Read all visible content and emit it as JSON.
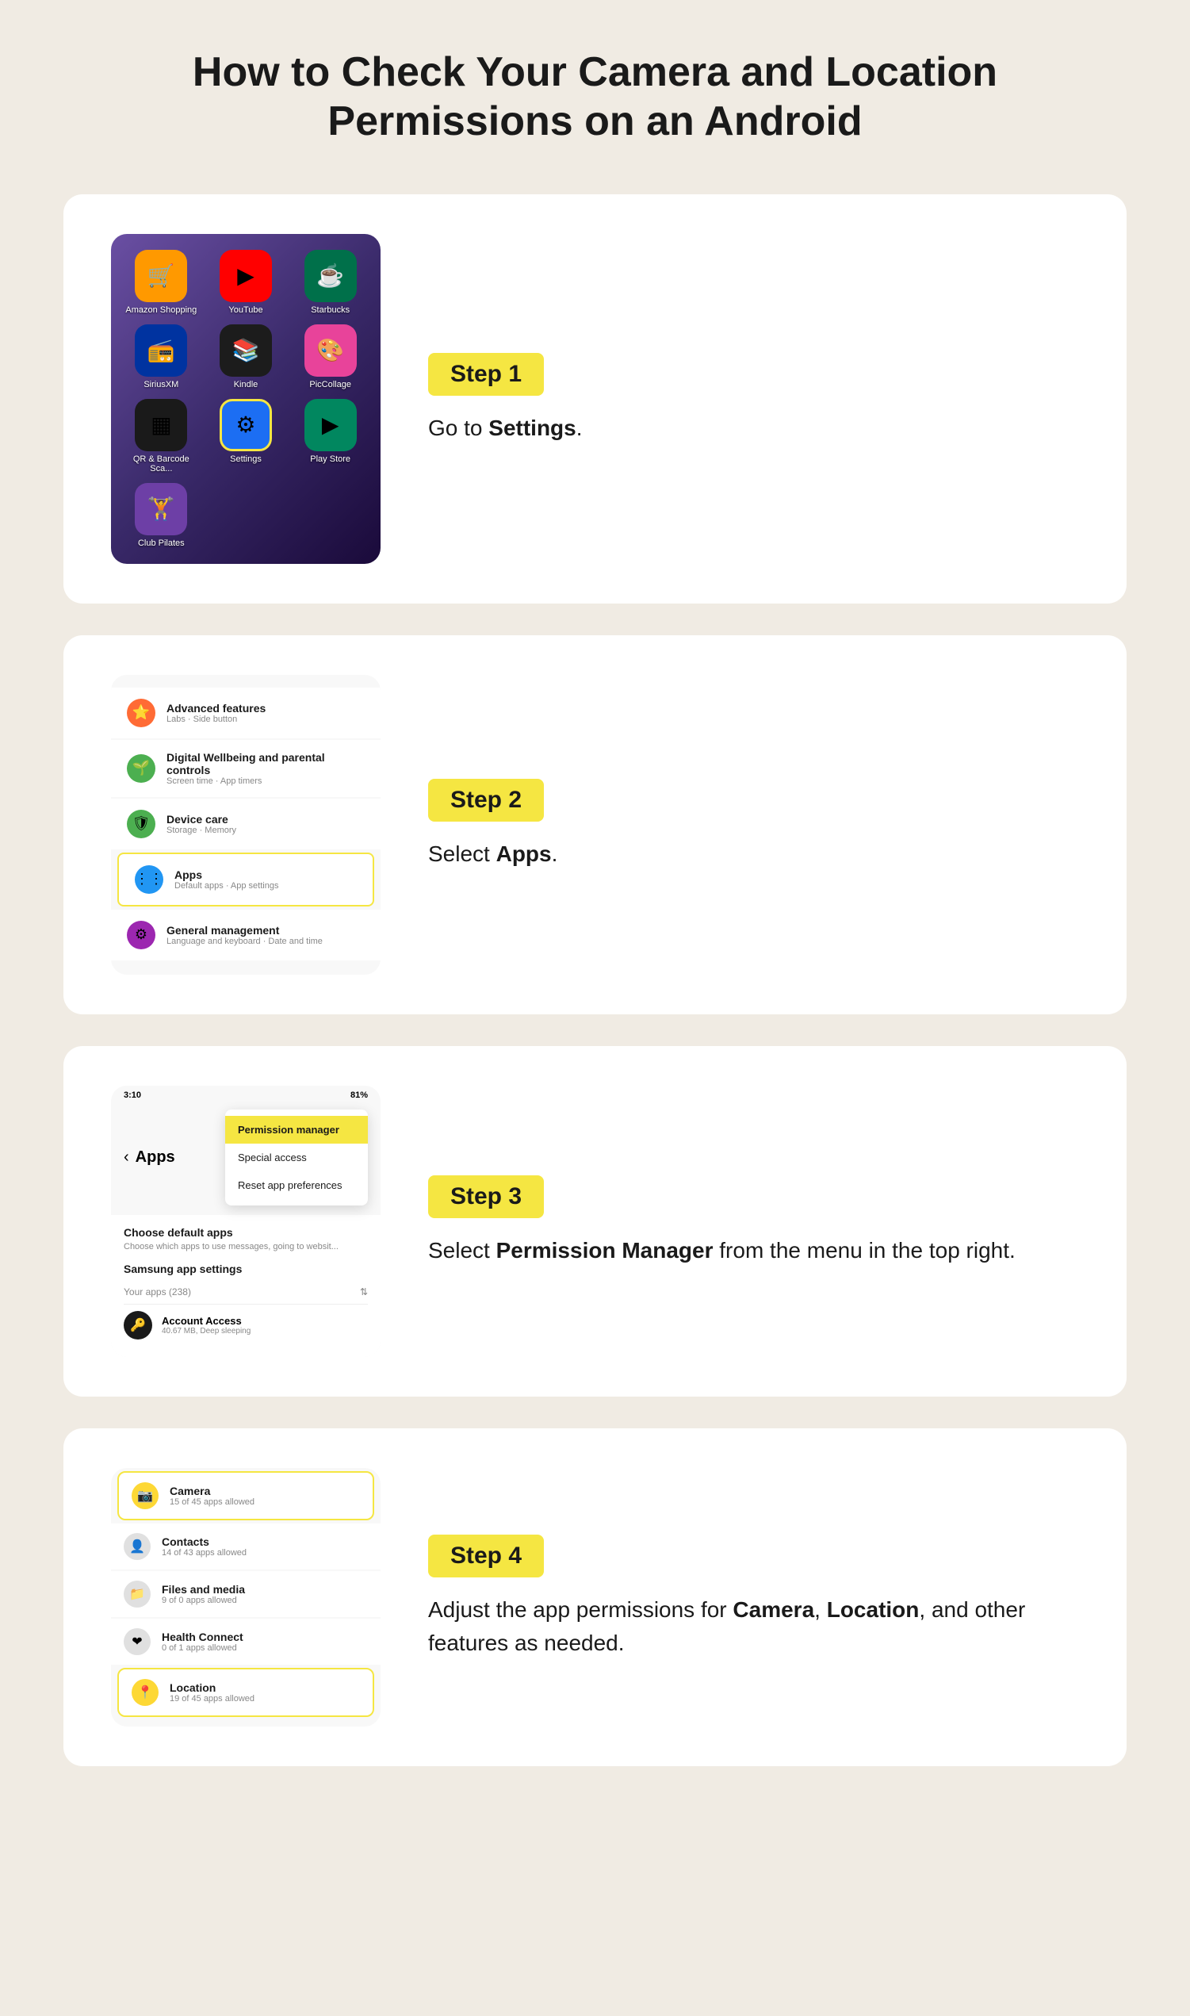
{
  "page": {
    "title": "How to Check Your Camera and Location Permissions on an Android",
    "background": "#f0ebe3"
  },
  "steps": [
    {
      "id": "step1",
      "badge": "Step 1",
      "description_before": "Go to ",
      "description_bold": "Settings",
      "description_after": ".",
      "apps": [
        {
          "label": "Amazon Shopping",
          "emoji": "🛒",
          "bg": "#ff9900"
        },
        {
          "label": "YouTube",
          "emoji": "▶",
          "bg": "#ff0000"
        },
        {
          "label": "Starbucks",
          "emoji": "☕",
          "bg": "#00704a"
        },
        {
          "label": "SiriusXM",
          "emoji": "📻",
          "bg": "#0033a0"
        },
        {
          "label": "Kindle",
          "emoji": "📚",
          "bg": "#1c1c1c"
        },
        {
          "label": "PicCollage",
          "emoji": "🎨",
          "bg": "#e8439a"
        },
        {
          "label": "QR & Barcode Sca...",
          "emoji": "▦",
          "bg": "#1a1a1a"
        },
        {
          "label": "Settings",
          "emoji": "⚙",
          "bg": "#1c6ef3",
          "highlighted": true
        },
        {
          "label": "Play Store",
          "emoji": "▶",
          "bg": "#01875f"
        },
        {
          "label": "Club Pilates",
          "emoji": "🏋",
          "bg": "#6d3fa6"
        }
      ]
    },
    {
      "id": "step2",
      "badge": "Step 2",
      "description_before": "Select ",
      "description_bold": "Apps",
      "description_after": ".",
      "settings": [
        {
          "icon": "⭐",
          "iconBg": "#ff6b35",
          "title": "Advanced features",
          "sub": "Labs · Side button"
        },
        {
          "icon": "🌱",
          "iconBg": "#4caf50",
          "title": "Digital Wellbeing and parental controls",
          "sub": "Screen time · App timers"
        },
        {
          "icon": "🛡",
          "iconBg": "#4caf50",
          "title": "Device care",
          "sub": "Storage · Memory"
        },
        {
          "icon": "⋮⋮",
          "iconBg": "#2196f3",
          "title": "Apps",
          "sub": "Default apps · App settings",
          "highlighted": true
        },
        {
          "icon": "⚙",
          "iconBg": "#9c27b0",
          "title": "General management",
          "sub": "Language and keyboard · Date and time"
        }
      ]
    },
    {
      "id": "step3",
      "badge": "Step 3",
      "description_before": "Select ",
      "description_bold": "Permission Manager",
      "description_after": " from the menu in the top right.",
      "statusBar": {
        "time": "3:10",
        "battery": "81%"
      },
      "headerTitle": "Apps",
      "dropdown": [
        {
          "label": "Permission manager",
          "active": true
        },
        {
          "label": "Special access",
          "active": false
        },
        {
          "label": "Reset app preferences",
          "active": false
        }
      ],
      "appsBody": {
        "sectionTitle": "Choose default apps",
        "sectionSub": "Choose which apps to use messages, going to websit...",
        "samsungTitle": "Samsung app settings",
        "countLabel": "Your apps (238)",
        "listItem": {
          "name": "Account Access",
          "sub": "40.67 MB, Deep sleeping"
        }
      }
    },
    {
      "id": "step4",
      "badge": "Step 4",
      "description_before": "Adjust the app permissions for ",
      "description_bold1": "Camera",
      "description_middle": ", ",
      "description_bold2": "Location",
      "description_after": ", and other features as needed.",
      "permissions": [
        {
          "icon": "📷",
          "iconBg": "#fdd835",
          "name": "Camera",
          "count": "15 of 45 apps allowed",
          "highlighted": true
        },
        {
          "icon": "👤",
          "iconBg": "#e0e0e0",
          "name": "Contacts",
          "count": "14 of 43 apps allowed",
          "highlighted": false
        },
        {
          "icon": "📁",
          "iconBg": "#e0e0e0",
          "name": "Files and media",
          "count": "9 of 0 apps allowed",
          "highlighted": false
        },
        {
          "icon": "❤",
          "iconBg": "#e0e0e0",
          "name": "Health Connect",
          "count": "0 of 1 apps allowed",
          "highlighted": false
        },
        {
          "icon": "📍",
          "iconBg": "#fdd835",
          "name": "Location",
          "count": "19 of 45 apps allowed",
          "highlighted": true
        }
      ]
    }
  ]
}
